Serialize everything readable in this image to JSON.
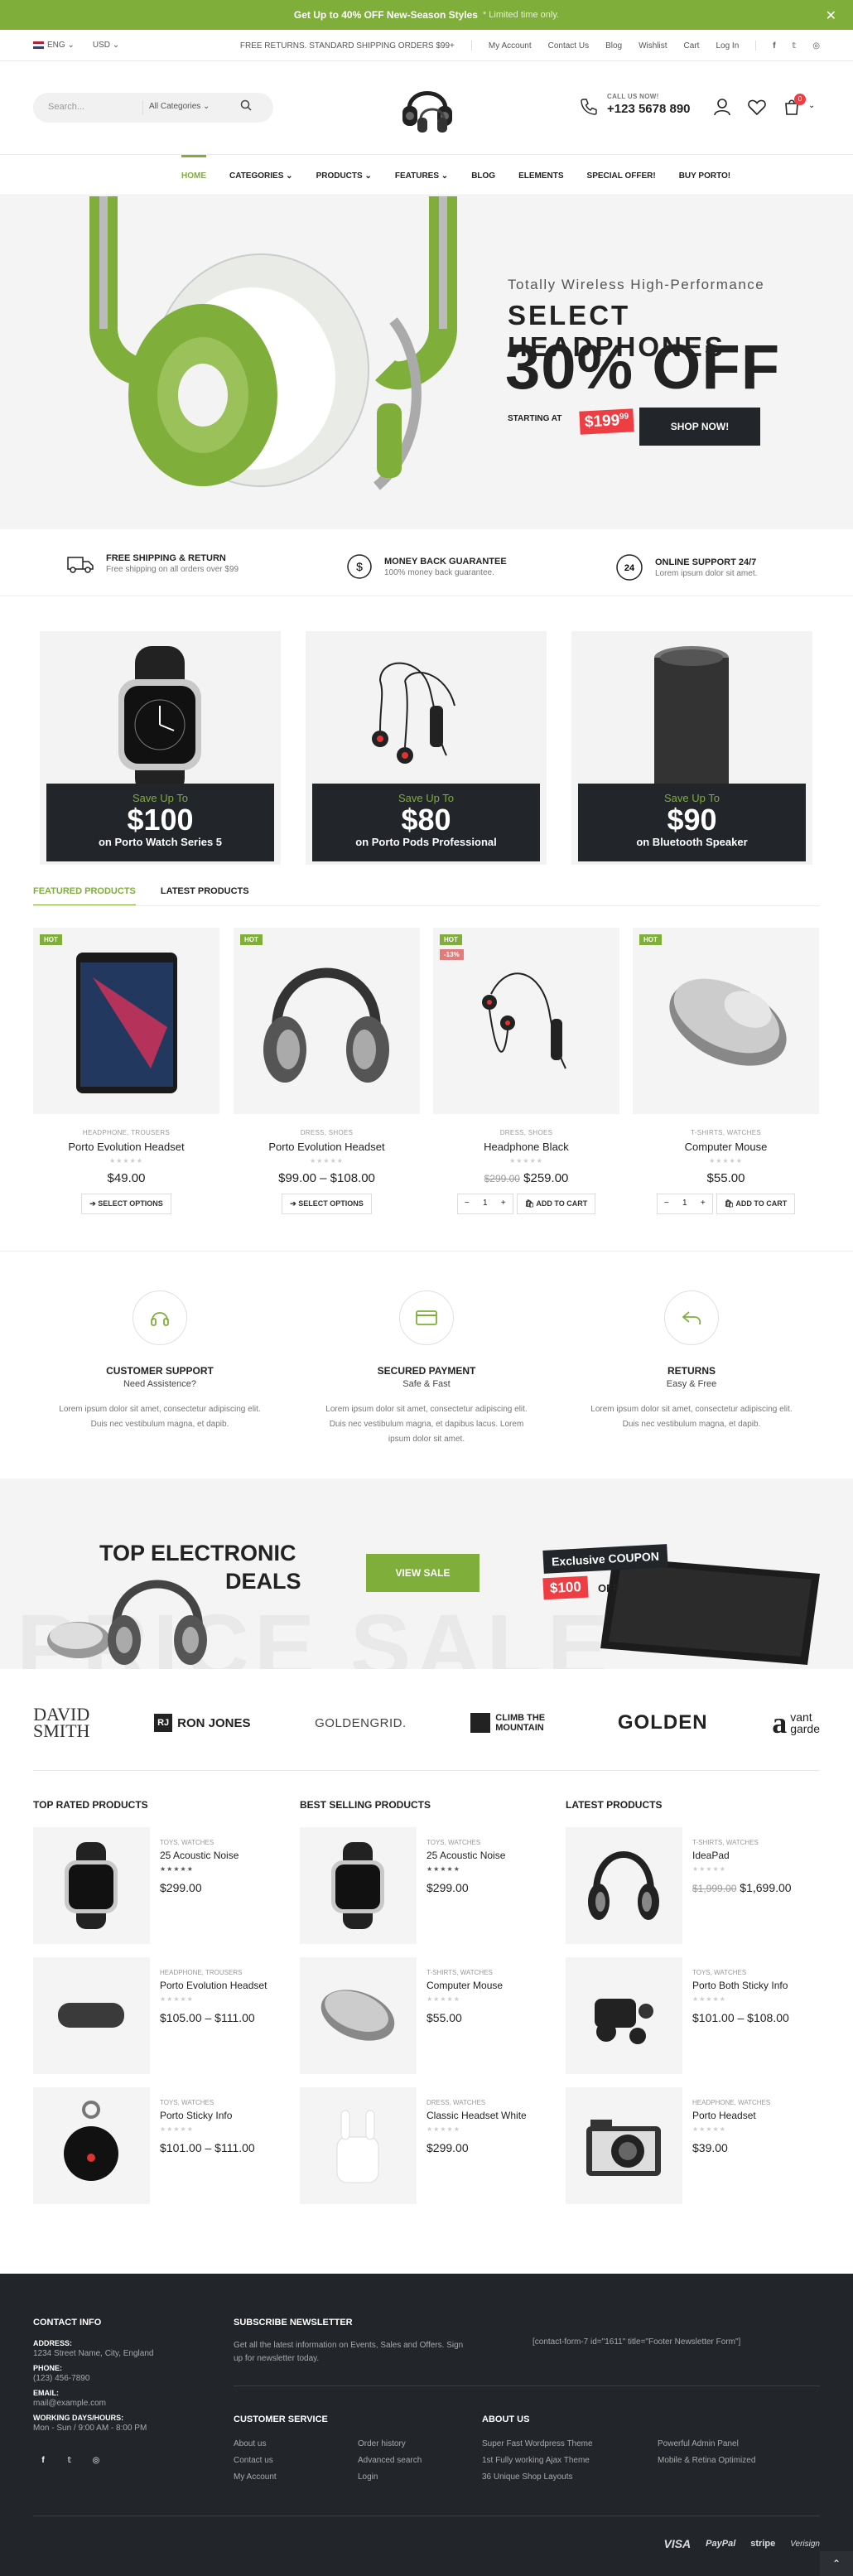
{
  "promo": {
    "strong": "Get Up to 40% OFF New-Season Styles",
    "sub": "* Limited time only."
  },
  "util": {
    "lang": "ENG",
    "currency": "USD",
    "shipping": "FREE RETURNS. STANDARD SHIPPING ORDERS $99+",
    "links": [
      "My Account",
      "Contact Us",
      "Blog",
      "Wishlist",
      "Cart",
      "Log In"
    ]
  },
  "header": {
    "search_placeholder": "Search...",
    "category": "All Categories",
    "call_label": "CALL US NOW!",
    "phone": "+123 5678 890",
    "cart_count": "0"
  },
  "nav": [
    "HOME",
    "CATEGORIES",
    "PRODUCTS",
    "FEATURES",
    "BLOG",
    "ELEMENTS",
    "SPECIAL OFFER!",
    "BUY PORTO!"
  ],
  "hero": {
    "tag": "Totally Wireless High-Performance",
    "title": "SELECT HEADPHONES",
    "off": "30% OFF",
    "starting": "STARTING AT",
    "price": "$199",
    "price_sup": "99",
    "button": "SHOP NOW!"
  },
  "features": [
    {
      "title": "FREE SHIPPING & RETURN",
      "desc": "Free shipping on all orders over $99"
    },
    {
      "title": "MONEY BACK GUARANTEE",
      "desc": "100% money back guarantee."
    },
    {
      "title": "ONLINE SUPPORT 24/7",
      "desc": "Lorem ipsum dolor sit amet."
    }
  ],
  "banners": [
    {
      "save": "Save Up To",
      "price": "$100",
      "name": "on Porto Watch Series 5"
    },
    {
      "save": "Save Up To",
      "price": "$80",
      "name": "on Porto Pods Professional"
    },
    {
      "save": "Save Up To",
      "price": "$90",
      "name": "on Bluetooth Speaker"
    }
  ],
  "tabs": [
    "FEATURED PRODUCTS",
    "LATEST PRODUCTS"
  ],
  "products": [
    {
      "badge": "HOT",
      "cat": "HEADPHONE, TROUSERS",
      "name": "Porto Evolution Headset",
      "price": "$49.00",
      "old": "",
      "action": "SELECT OPTIONS"
    },
    {
      "badge": "HOT",
      "cat": "DRESS, SHOES",
      "name": "Porto Evolution Headset",
      "price": "$99.00 – $108.00",
      "old": "",
      "action": "SELECT OPTIONS"
    },
    {
      "badge": "HOT",
      "sale": "-13%",
      "cat": "DRESS, SHOES",
      "name": "Headphone Black",
      "price": "$259.00",
      "old": "$299.00",
      "action": "ADD TO CART"
    },
    {
      "badge": "HOT",
      "cat": "T-SHIRTS, WATCHES",
      "name": "Computer Mouse",
      "price": "$55.00",
      "old": "",
      "action": "ADD TO CART"
    }
  ],
  "qty": "1",
  "services": [
    {
      "title": "CUSTOMER SUPPORT",
      "sub": "Need Assistence?",
      "desc": "Lorem ipsum dolor sit amet, consectetur adipiscing elit. Duis nec vestibulum magna, et dapib."
    },
    {
      "title": "SECURED PAYMENT",
      "sub": "Safe & Fast",
      "desc": "Lorem ipsum dolor sit amet, consectetur adipiscing elit. Duis nec vestibulum magna, et dapibus lacus. Lorem ipsum dolor sit amet."
    },
    {
      "title": "RETURNS",
      "sub": "Easy & Free",
      "desc": "Lorem ipsum dolor sit amet, consectetur adipiscing elit. Duis nec vestibulum magna, et dapib."
    }
  ],
  "deals": {
    "t1": "TOP ELECTRONIC",
    "t2": "DEALS",
    "button": "VIEW SALE",
    "coupon": "Exclusive COUPON",
    "coupon_value": "$100",
    "coupon_off": "OFF",
    "bg": "PRICE SALE"
  },
  "brands": {
    "david1": "DAVID",
    "david2": "SMITH",
    "ron": "RON JONES",
    "rj": "RJ",
    "golden": "GOLDENGRID.",
    "climb": "CLIMB THE MOUNTAIN",
    "golden2": "GOLDEN",
    "vant1": "vant",
    "vant2": "garde"
  },
  "lists": [
    {
      "title": "TOP RATED PRODUCTS",
      "items": [
        {
          "cat": "TOYS, WATCHES",
          "name": "25 Acoustic Noise",
          "price": "$299.00",
          "old": ""
        },
        {
          "cat": "HEADPHONE, TROUSERS",
          "name": "Porto Evolution Headset",
          "price": "$105.00 – $111.00",
          "old": ""
        },
        {
          "cat": "TOYS, WATCHES",
          "name": "Porto Sticky Info",
          "price": "$101.00 – $111.00",
          "old": ""
        }
      ]
    },
    {
      "title": "BEST SELLING PRODUCTS",
      "items": [
        {
          "cat": "TOYS, WATCHES",
          "name": "25 Acoustic Noise",
          "price": "$299.00",
          "old": ""
        },
        {
          "cat": "T-SHIRTS, WATCHES",
          "name": "Computer Mouse",
          "price": "$55.00",
          "old": ""
        },
        {
          "cat": "DRESS, WATCHES",
          "name": "Classic Headset White",
          "price": "$299.00",
          "old": ""
        }
      ]
    },
    {
      "title": "LATEST PRODUCTS",
      "items": [
        {
          "cat": "T-SHIRTS, WATCHES",
          "name": "IdeaPad",
          "price": "$1,699.00",
          "old": "$1,999.00"
        },
        {
          "cat": "TOYS, WATCHES",
          "name": "Porto Both Sticky Info",
          "price": "$101.00 – $108.00",
          "old": ""
        },
        {
          "cat": "HEADPHONE, WATCHES",
          "name": "Porto Headset",
          "price": "$39.00",
          "old": ""
        }
      ]
    }
  ],
  "footer": {
    "contact_title": "CONTACT INFO",
    "address_label": "ADDRESS:",
    "address": "1234 Street Name, City, England",
    "phone_label": "PHONE:",
    "phone": "(123) 456-7890",
    "email_label": "EMAIL:",
    "email": "mail@example.com",
    "hours_label": "WORKING DAYS/HOURS:",
    "hours": "Mon - Sun / 9:00 AM - 8:00 PM",
    "news_title": "SUBSCRIBE NEWSLETTER",
    "news_text": "Get all the latest information on Events, Sales and Offers. Sign up for newsletter today.",
    "form_code": "[contact-form-7 id=\"1611\" title=\"Footer Newsletter Form\"]",
    "cs_title": "CUSTOMER SERVICE",
    "cs_links": [
      "About us",
      "Contact us",
      "My Account",
      "Order history",
      "Advanced search",
      "Login"
    ],
    "about_title": "ABOUT US",
    "about_links": [
      "Super Fast Wordpress Theme",
      "1st Fully working Ajax Theme",
      "36 Unique Shop Layouts",
      "Powerful Admin Panel",
      "Mobile & Retina Optimized"
    ],
    "pay": [
      "VISA",
      "PayPal",
      "stripe",
      "Verisign"
    ]
  },
  "colors": {
    "accent": "#7fae3a",
    "dark": "#222529",
    "sale": "#ee3d43"
  }
}
